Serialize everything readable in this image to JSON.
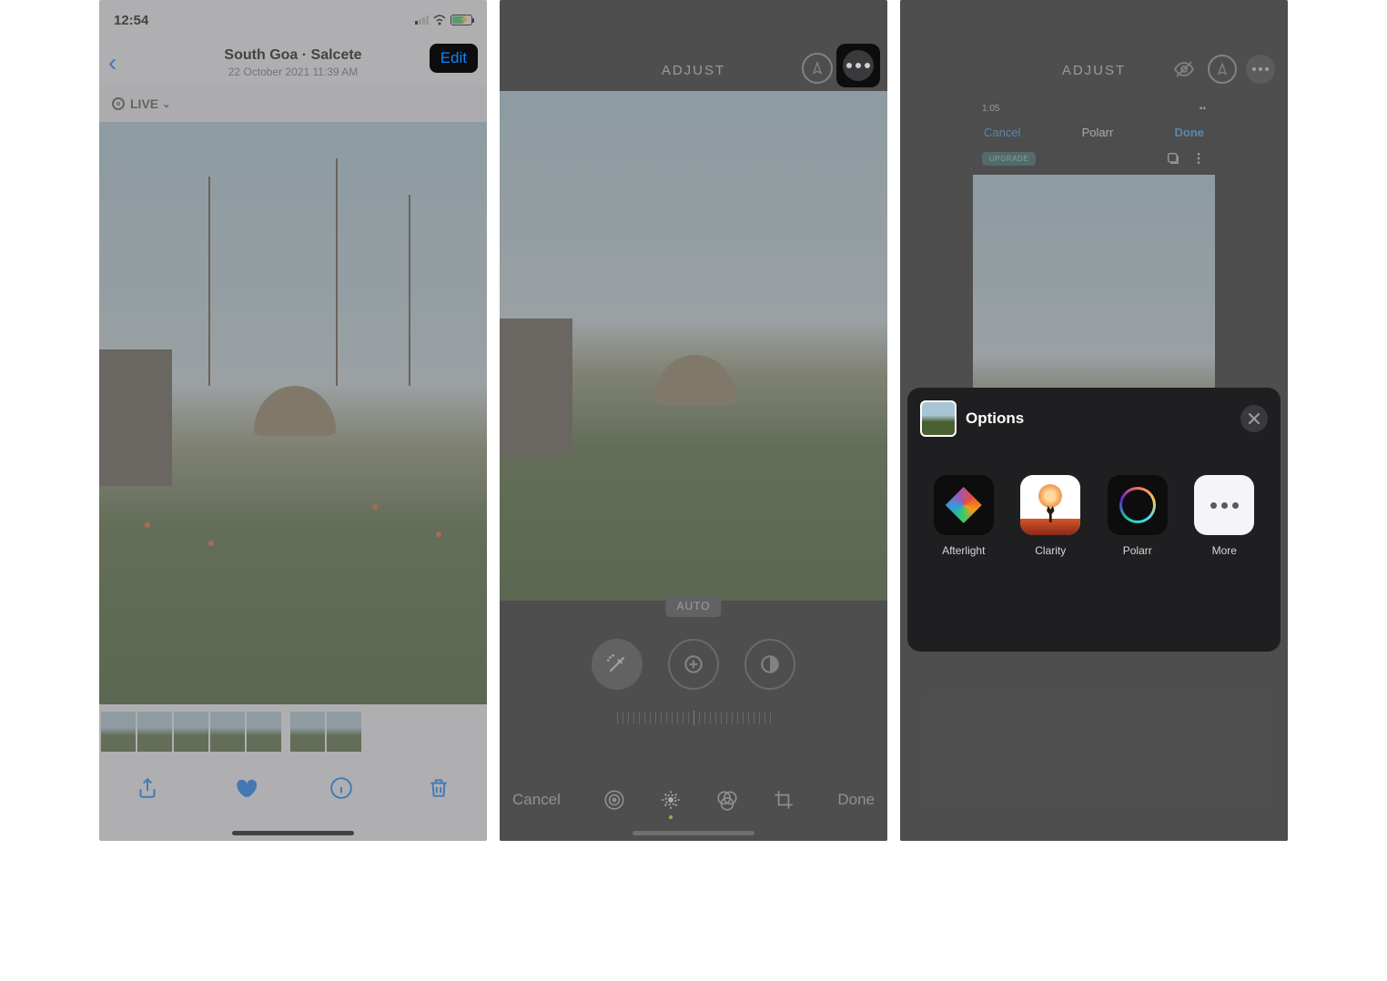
{
  "panel1": {
    "status": {
      "time": "12:54"
    },
    "nav": {
      "location": "South Goa · Salcete",
      "timestamp": "22 October 2021  11:39 AM",
      "edit": "Edit"
    },
    "live": {
      "label": "LIVE"
    },
    "toolbar": {
      "share": "share-icon",
      "favorite": "heart-icon",
      "info": "info-icon",
      "delete": "trash-icon"
    }
  },
  "panel2": {
    "nav": {
      "title": "ADJUST"
    },
    "auto_label": "AUTO",
    "bottom": {
      "cancel": "Cancel",
      "done": "Done"
    }
  },
  "panel3": {
    "nav": {
      "title": "ADJUST"
    },
    "polarr": {
      "status_time": "1:05",
      "cancel": "Cancel",
      "title": "Polarr",
      "done": "Done",
      "upgrade": "UPGRADE"
    },
    "sheet": {
      "title": "Options",
      "apps": [
        {
          "name": "Afterlight"
        },
        {
          "name": "Clarity"
        },
        {
          "name": "Polarr"
        },
        {
          "name": "More"
        }
      ]
    }
  }
}
